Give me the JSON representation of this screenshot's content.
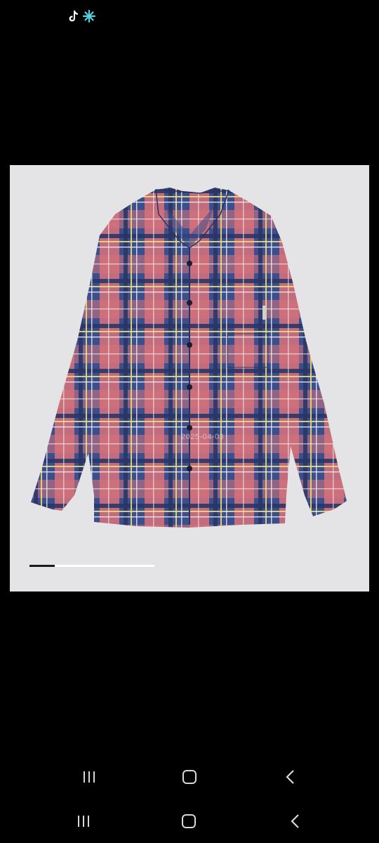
{
  "status_bar": {
    "icons": [
      "tiktok-icon",
      "sparkle-icon"
    ]
  },
  "viewer": {
    "image": "plaid-flannel-shirt",
    "watermark": "2025-04-03",
    "progress": 0.2
  },
  "nav_bar_upper": {
    "buttons": [
      "recent-apps-icon",
      "home-icon",
      "back-icon"
    ]
  },
  "nav_bar_lower": {
    "buttons": [
      "recent-apps-icon",
      "home-icon",
      "back-icon"
    ]
  },
  "colors": {
    "background": "#000000",
    "viewer_bg": "#e4e4e6",
    "plaid_blue": "#3b4f8c",
    "plaid_red": "#d9727a",
    "sparkle": "#4fd6e0"
  }
}
